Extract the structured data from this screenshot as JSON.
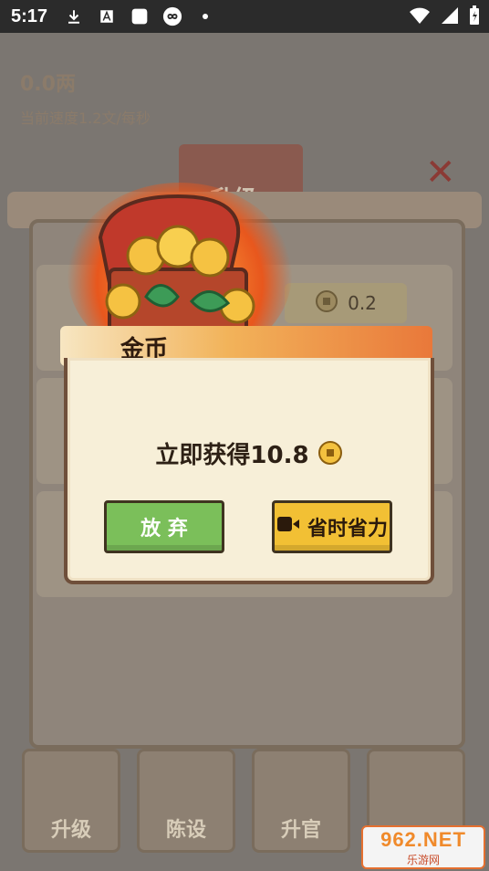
{
  "status_bar": {
    "time": "5:17"
  },
  "background": {
    "currency_text": "0.0两",
    "speed_text": "当前速度1.2文/每秒",
    "title_text": "升级",
    "row_value": "0.2",
    "tabs": [
      "升级",
      "陈设",
      "升官",
      ""
    ]
  },
  "dialog": {
    "title": "金币",
    "message": "立即获得10.8",
    "buttons": {
      "give_up": "放 弃",
      "watch": "省时省力"
    }
  },
  "watermark": {
    "main": "962.NET",
    "sub": "乐游网"
  },
  "colors": {
    "accent_green": "#7bbf5a",
    "accent_yellow": "#f2c034",
    "dialog_bg": "#f7efd8",
    "header_orange": "#e9783a"
  }
}
